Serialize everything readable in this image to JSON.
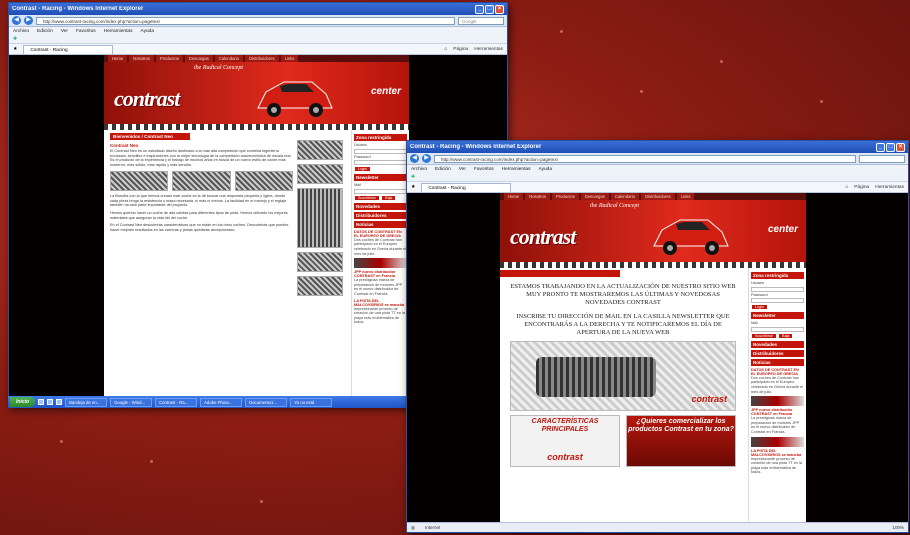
{
  "window1": {
    "title": "Contrast - Racing - Windows Internet Explorer",
    "url": "http://www.contrast-racing.com/index.php?action=pagetext",
    "search_placeholder": "Google",
    "menu": [
      "Archivo",
      "Edición",
      "Ver",
      "Favoritos",
      "Herramientas",
      "Ayuda"
    ],
    "tab_label": "Contrast - Racing",
    "tools": [
      "Página",
      "Herramientas"
    ]
  },
  "window2": {
    "title": "Contrast - Racing - Windows Internet Explorer",
    "url": "http://www.contrast-racing.com/index.php?action=pagetext",
    "menu": [
      "Archivo",
      "Edición",
      "Ver",
      "Favoritos",
      "Herramientas",
      "Ayuda"
    ],
    "tab_label": "Contrast - Racing",
    "tools": [
      "Página",
      "Herramientas"
    ],
    "status": "Internet",
    "zoom": "100%"
  },
  "site": {
    "nav": [
      "Home",
      "Nosotros",
      "Productos",
      "Descargas",
      "Calendario",
      "Distribuidores",
      "Links"
    ],
    "slogan": "the Radical Concept",
    "logo": "contrast",
    "center": "center",
    "section_title": "Bienvenidos / Contrast Neo",
    "para1_head": "Contrast Neo",
    "para1": "El Contrast Neo es un estudiado diseño destinado a la más alta competición que combina ingeniería exclusiva, sencillez e inspiraciones con la mejor tecnología de la competición automovilística de escala real. Es el producto de la experiencia y el trabajo de muchos años en busca de un nuevo estilo de coche más moderno, más sólido, más rápido y más sencillo.",
    "para2": "La filosofía con la que hemos creado este coche es la de buscar una respuesta pequeña y ligera, donde cada pieza tenga la resistencia y masa necesaria, ni más ni menos. La facilidad en el manejo y el reglaje también ha sido parte importante del proyecto.",
    "para3": "Hemos querido hacer un coche de alta calidad para diferentes tipos de pista. Hemos utilizado los mejores materiales que aseguran la vida útil del coche.",
    "para4": "En el Contrast Neo descubrirás características que no están en los otros coches. Descubrirás que puedes hacer mejores resultados en las carreras y jamás quedarás decepcionado.",
    "notice1": "ESTAMOS TRABAJANDO EN LA ACTUALIZACIÓN DE NUESTRO SITIO WEB",
    "notice2": "MUY PRONTO TE MOSTRAREMOS LAS ÚLTIMAS Y NOVEDOSAS NOVEDADES CONTRAST",
    "notice3": "INSCRIBE TU DIRECCIÓN DE MAIL EN LA CASILLA NEWSLETTER QUE ENCONTRARÁS A LA DERECHA Y TE NOTIFICAREMOS EL DÍA DE APERTURA DE LA NUEVA WEB",
    "promo_left": "CARACTERÍSTICAS PRINCIPALES",
    "promo_right": "¿Quieres comercializar los productos Contrast en tu zona?",
    "promo_logo": "contrast"
  },
  "sidebar": {
    "login_head": "Zona restringida",
    "user_label": "Usuario",
    "pass_label": "Password",
    "login_btn": "Login",
    "news_head": "Newsletter",
    "mail_label": "Mail",
    "subscribe_btn": "Suscribirse",
    "unsubscribe_btn": "Baja",
    "links": [
      "Novedades",
      "Distribuidores",
      "Noticias"
    ],
    "news1_title": "DATOS DE CONTRAST EN EL EUROPEO DE GRECIA",
    "news1_text": "Dos coches de Contrast han participado en el Europeo celebrado en Grecia durante el mes de julio.",
    "news2_title": "JPP nuevo distribuidor CONTRAST en Francia",
    "news2_text": "La prestigiosa marca de preparación de motores JPP es el nuevo distribuidor de Contrast en Francia.",
    "news3_title": "LA PISTA DEL MALCOVIDRIOS se mancha",
    "news3_text": "Impresionante proceso de creación de una pista TT en la playa más emblemática de todos."
  },
  "taskbar": {
    "start": "Inicio",
    "items": [
      "Bandeja de en...",
      "Google - Wind...",
      "Contrast - Ra...",
      "Adobe Photo...",
      "Documento1...",
      "Ya no está"
    ]
  },
  "colors": {
    "brand_red": "#c4150b",
    "ie_blue": "#1f4fb4",
    "dark": "#050000"
  }
}
